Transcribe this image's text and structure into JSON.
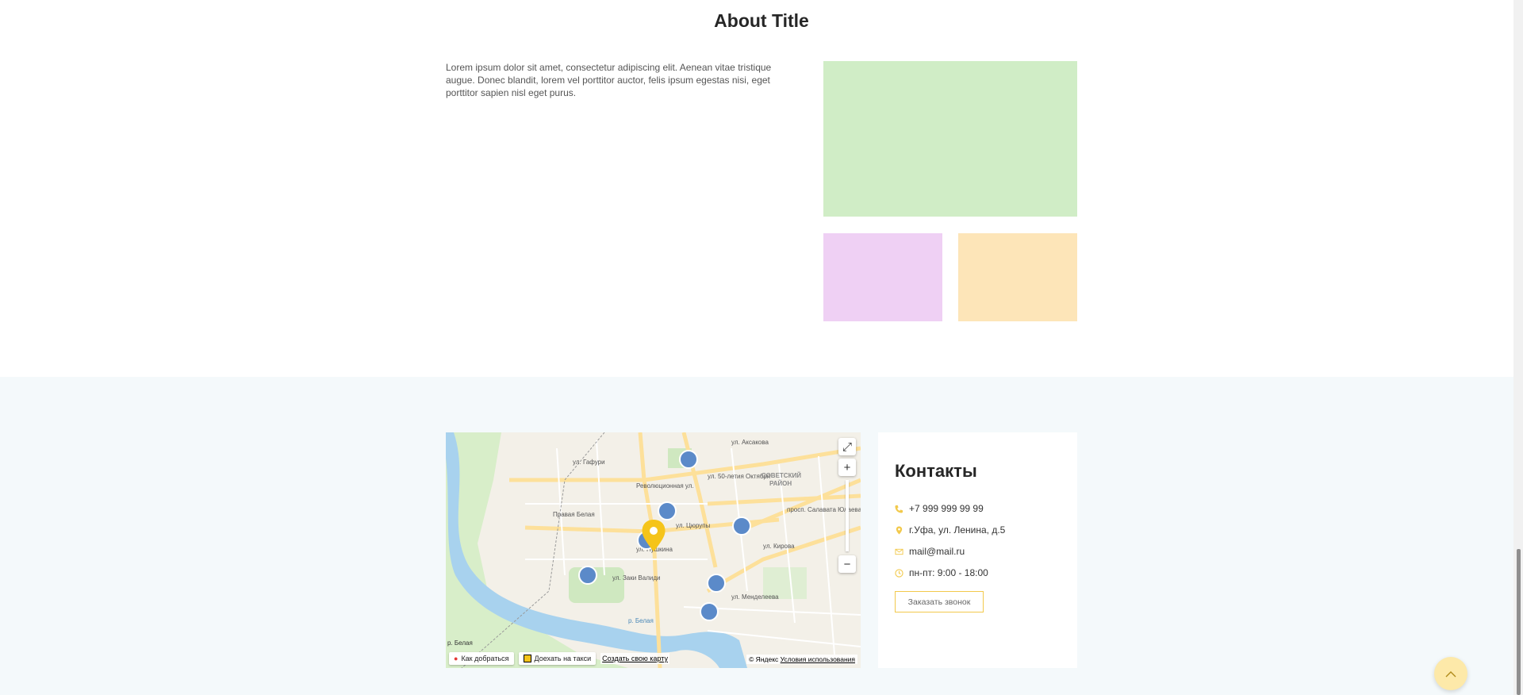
{
  "about": {
    "title": "About Title",
    "text": "Lorem ipsum dolor sit amet, consectetur adipiscing elit. Aenean vitae tristique augue. Donec blandit, lorem vel porttitor auctor, felis ipsum egestas nisi, eget porttitor sapien nisl eget purus."
  },
  "colors": {
    "tile_green": "#d0edc6",
    "tile_pink": "#efd0f4",
    "tile_orange": "#fde5b8",
    "accent": "#f2c94c",
    "footer_bg": "#f4f9fb"
  },
  "map": {
    "labels": {
      "street_1": "Революционная ул.",
      "street_2": "ул. 50-летия Октября",
      "district": "СОВЕТСКИЙ",
      "district_2": "РАЙОН",
      "street_3": "ул. Кирова",
      "street_4": "ул. Цюрупы",
      "street_5": "ул. Пушкина",
      "street_6": "ул. Заки Валиди",
      "street_7": "ул. Менделеева",
      "river": "р. Белая",
      "river_2": "р. Белая",
      "station": "Правая Белая",
      "street_8": "просп. Салавата Юлаева",
      "street_9": "ул. Гафури",
      "street_10": "ул. Аксакова"
    },
    "route_label": "Как добраться",
    "taxi_label": "Доехать на такси",
    "create_map_label": "Создать свою карту",
    "copyright": "© Яндекс",
    "terms_label": "Условия использования",
    "icons": [
      "fullscreen-icon",
      "zoom-in-icon",
      "zoom-out-icon",
      "location-pin-icon",
      "taxi-icon"
    ]
  },
  "contacts": {
    "title": "Контакты",
    "phone": "+7 999 999 99 99",
    "address": "г.Уфа, ул. Ленина, д.5",
    "email": "mail@mail.ru",
    "hours": "пн-пт: 9:00 - 18:00",
    "callback_button": "Заказать звонок",
    "icons": [
      "phone-icon",
      "location-icon",
      "mail-icon",
      "clock-icon"
    ]
  },
  "scroll_top_icon": "chevron-up-icon"
}
